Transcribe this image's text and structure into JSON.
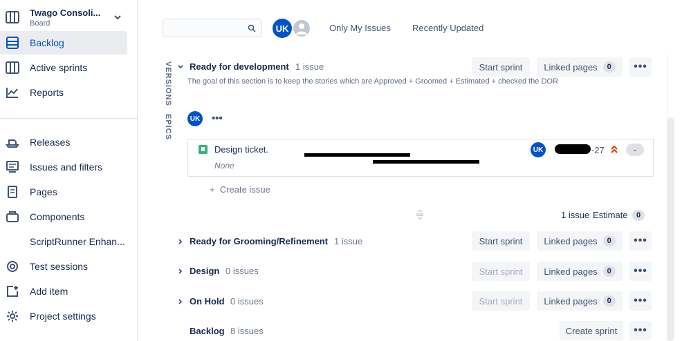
{
  "sidebar": {
    "project_title": "Twago Consoli...",
    "project_subtitle": "Board",
    "items": [
      {
        "label": "Backlog",
        "icon": "backlog-icon",
        "active": true
      },
      {
        "label": "Active sprints",
        "icon": "board-icon"
      },
      {
        "label": "Reports",
        "icon": "reports-icon"
      },
      {
        "label": "Releases",
        "icon": "releases-icon"
      },
      {
        "label": "Issues and filters",
        "icon": "issues-icon"
      },
      {
        "label": "Pages",
        "icon": "pages-icon"
      },
      {
        "label": "Components",
        "icon": "components-icon"
      },
      {
        "label": "ScriptRunner Enhan...",
        "icon": ""
      },
      {
        "label": "Test sessions",
        "icon": "test-sessions-icon"
      },
      {
        "label": "Add item",
        "icon": "add-item-icon"
      },
      {
        "label": "Project settings",
        "icon": "gear-icon"
      }
    ]
  },
  "toolbar": {
    "search_placeholder": "",
    "avatar_initials": "UK",
    "filter_my_issues": "Only My Issues",
    "filter_recent": "Recently Updated"
  },
  "side_tabs": {
    "versions": "VERSIONS",
    "epics": "EPICS"
  },
  "sections": [
    {
      "name": "Ready for development",
      "count": "1 issue",
      "start_sprint": "Start sprint",
      "linked_pages": "Linked pages",
      "linked_count": "0",
      "goal": "The goal of this section is to keep the stories which are Approved + Groomed + Estimated + checked the DOR",
      "enabled": true
    },
    {
      "name": "Ready for Grooming/Refinement",
      "count": "1 issue",
      "start_sprint": "Start sprint",
      "linked_pages": "Linked pages",
      "linked_count": "0",
      "enabled": true
    },
    {
      "name": "Design",
      "count": "0 issues",
      "start_sprint": "Start sprint",
      "linked_pages": "Linked pages",
      "linked_count": "0",
      "enabled": false
    },
    {
      "name": "On Hold",
      "count": "0 issues",
      "start_sprint": "Start sprint",
      "linked_pages": "Linked pages",
      "linked_count": "0",
      "enabled": false
    }
  ],
  "backlog": {
    "name": "Backlog",
    "count": "8 issues",
    "create_sprint": "Create sprint"
  },
  "issue": {
    "summary": "Design ticket.",
    "epic": "None",
    "assignee": "UK",
    "key_suffix": "-27",
    "estimate": "-"
  },
  "create_issue": "Create issue",
  "sprint_summary": {
    "issues": "1 issue",
    "estimate_label": "Estimate",
    "estimate_value": "0"
  },
  "more_label": "•••",
  "colors": {
    "accent": "#0052cc",
    "issue_story": "#36b37e",
    "priority": "#de350b"
  }
}
